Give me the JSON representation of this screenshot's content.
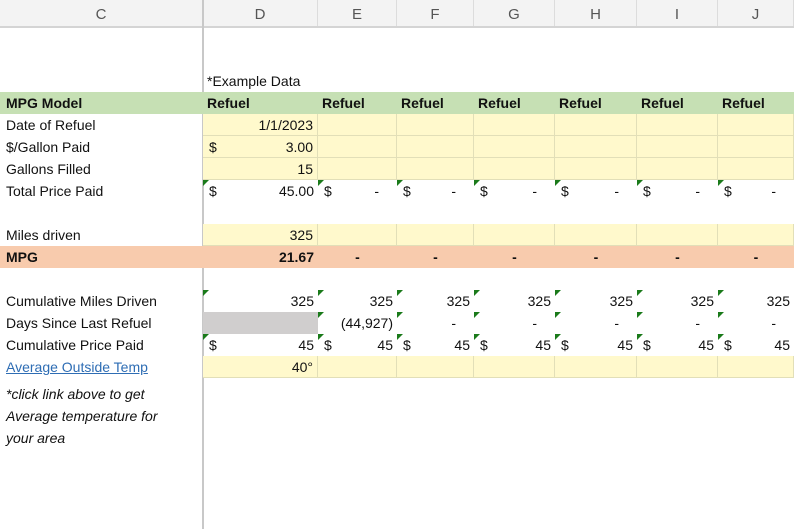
{
  "columns": [
    "C",
    "D",
    "E",
    "F",
    "G",
    "H",
    "I",
    "J"
  ],
  "example_note": "*Example Data",
  "header": {
    "label": "MPG Model",
    "refuel": "Refuel"
  },
  "rows": {
    "date": {
      "label": "Date of Refuel",
      "values": [
        "1/1/2023",
        "",
        "",
        "",
        "",
        "",
        ""
      ]
    },
    "price_per_gallon": {
      "label": "$/Gallon Paid",
      "currency": "$",
      "values": [
        "3.00",
        "",
        "",
        "",
        "",
        "",
        ""
      ]
    },
    "gallons": {
      "label": "Gallons Filled",
      "values": [
        "15",
        "",
        "",
        "",
        "",
        "",
        ""
      ]
    },
    "total_price": {
      "label": "Total Price Paid",
      "currency": "$",
      "values": [
        "45.00",
        "-",
        "-",
        "-",
        "-",
        "-",
        "-"
      ]
    },
    "miles": {
      "label": "Miles driven",
      "values": [
        "325",
        "",
        "",
        "",
        "",
        "",
        ""
      ]
    },
    "mpg": {
      "label": "MPG",
      "values": [
        "21.67",
        "-",
        "-",
        "-",
        "-",
        "-",
        "-"
      ]
    },
    "cum_miles": {
      "label": "Cumulative Miles Driven",
      "values": [
        "325",
        "325",
        "325",
        "325",
        "325",
        "325",
        "325"
      ]
    },
    "days_since": {
      "label": "Days Since Last Refuel",
      "values": [
        "",
        "(44,927)",
        "-",
        "-",
        "-",
        "-",
        "-"
      ]
    },
    "cum_price": {
      "label": "Cumulative Price Paid",
      "currency": "$",
      "values": [
        "45",
        "45",
        "45",
        "45",
        "45",
        "45",
        "45"
      ]
    },
    "avg_temp": {
      "label": "Average Outside Temp",
      "values": [
        "40°",
        "",
        "",
        "",
        "",
        "",
        ""
      ]
    }
  },
  "footnote": [
    "*click link above to get",
    "Average temperature for",
    "your area"
  ],
  "colors": {
    "green": "#c6e0b4",
    "yellow": "#fff9cc",
    "orange": "#f8cbad",
    "gray": "#d0cece",
    "link": "#2e6db4"
  }
}
